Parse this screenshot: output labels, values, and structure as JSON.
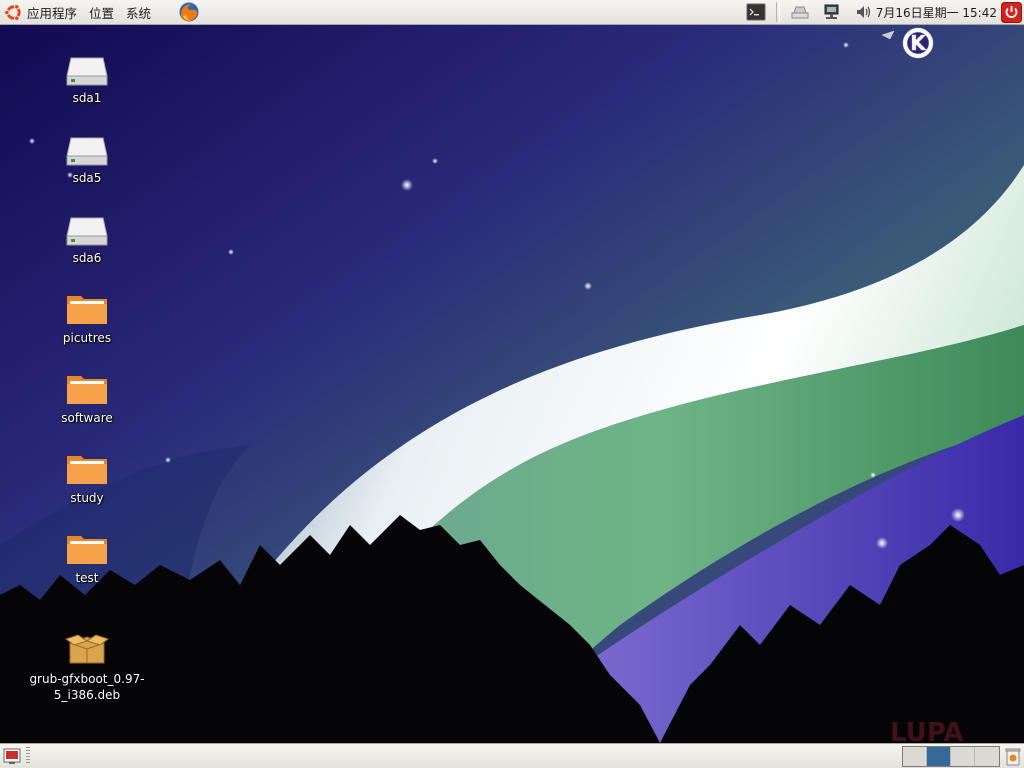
{
  "top_panel": {
    "menus": [
      {
        "label": "应用程序",
        "icon": "ubuntu-logo-icon"
      },
      {
        "label": "位置"
      },
      {
        "label": "系统"
      }
    ],
    "launchers": [
      {
        "icon": "firefox-icon"
      }
    ],
    "tray": {
      "icons": [
        "terminal-icon",
        "printer-icon",
        "network-icon",
        "volume-icon"
      ],
      "clock": "7月16日星期一 15:42",
      "power_icon": "power-icon"
    }
  },
  "desktop": {
    "icons": [
      {
        "label": "sda1",
        "icon": "drive-icon"
      },
      {
        "label": "sda5",
        "icon": "drive-icon"
      },
      {
        "label": "sda6",
        "icon": "drive-icon"
      },
      {
        "label": "picutres",
        "icon": "folder-icon"
      },
      {
        "label": "software",
        "icon": "folder-icon"
      },
      {
        "label": "study",
        "icon": "folder-icon"
      },
      {
        "label": "test",
        "icon": "folder-icon"
      },
      {
        "label": "grub-gfxboot_0.97-5_i386.deb",
        "label_lines": [
          "grub-gfxboot_0.97-",
          "5_i386.deb"
        ],
        "icon": "package-icon"
      }
    ],
    "wallpaper_logo": "K"
  },
  "bottom_panel": {
    "show_desktop_icon": "show-desktop-icon",
    "workspaces": 4,
    "active_workspace": 2,
    "trash_icon": "trash-icon"
  },
  "colors": {
    "panel_bg": "#ece9e3",
    "wallpaper_dark": "#1a0e5c",
    "folder_orange": "#f39c3b",
    "workspace_active": "#36689a",
    "power_red": "#d2231c"
  }
}
